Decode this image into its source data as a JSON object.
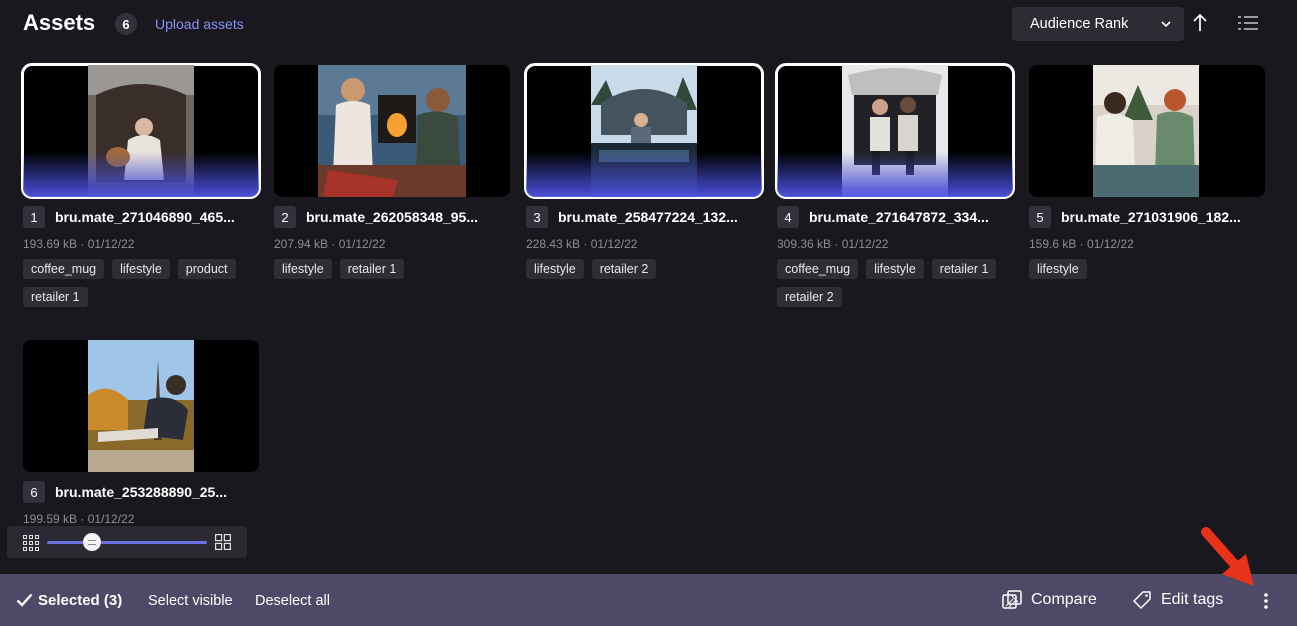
{
  "header": {
    "title": "Assets",
    "count": "6",
    "upload_label": "Upload assets",
    "sort_value": "Audience Rank",
    "icons": [
      "chevron-down-icon",
      "arrow-up-icon",
      "list-view-icon"
    ]
  },
  "assets": [
    {
      "index": "1",
      "name": "bru.mate_271046890_465...",
      "meta": "193.69 kB · 01/12/22",
      "tags": [
        "coffee_mug",
        "lifestyle",
        "product",
        "retailer 1"
      ],
      "selected": true
    },
    {
      "index": "2",
      "name": "bru.mate_262058348_95...",
      "meta": "207.94 kB · 01/12/22",
      "tags": [
        "lifestyle",
        "retailer 1"
      ],
      "selected": false
    },
    {
      "index": "3",
      "name": "bru.mate_258477224_132...",
      "meta": "228.43 kB · 01/12/22",
      "tags": [
        "lifestyle",
        "retailer 2"
      ],
      "selected": true
    },
    {
      "index": "4",
      "name": "bru.mate_271647872_334...",
      "meta": "309.36 kB · 01/12/22",
      "tags": [
        "coffee_mug",
        "lifestyle",
        "retailer 1",
        "retailer 2"
      ],
      "selected": true
    },
    {
      "index": "5",
      "name": "bru.mate_271031906_182...",
      "meta": "159.6 kB · 01/12/22",
      "tags": [
        "lifestyle"
      ],
      "selected": false
    },
    {
      "index": "6",
      "name": "bru.mate_253288890_25...",
      "meta": "199.59 kB · 01/12/22",
      "tags": [],
      "selected": false
    }
  ],
  "zoom": {
    "level": 0.3,
    "icons": [
      "small-grid-icon",
      "large-grid-icon"
    ]
  },
  "bottombar": {
    "selected_label": "Selected (3)",
    "select_visible": "Select visible",
    "deselect_all": "Deselect all",
    "compare": "Compare",
    "edit_tags": "Edit tags",
    "icons": [
      "checkmark-icon",
      "compare-icon",
      "tag-icon",
      "more-vertical-icon"
    ]
  },
  "colors": {
    "background": "#19181f",
    "accent": "#8b8ff0",
    "bottombar": "#4c4a66",
    "selection_overlay": "#5056e1",
    "annotation_arrow": "#e8321a"
  }
}
